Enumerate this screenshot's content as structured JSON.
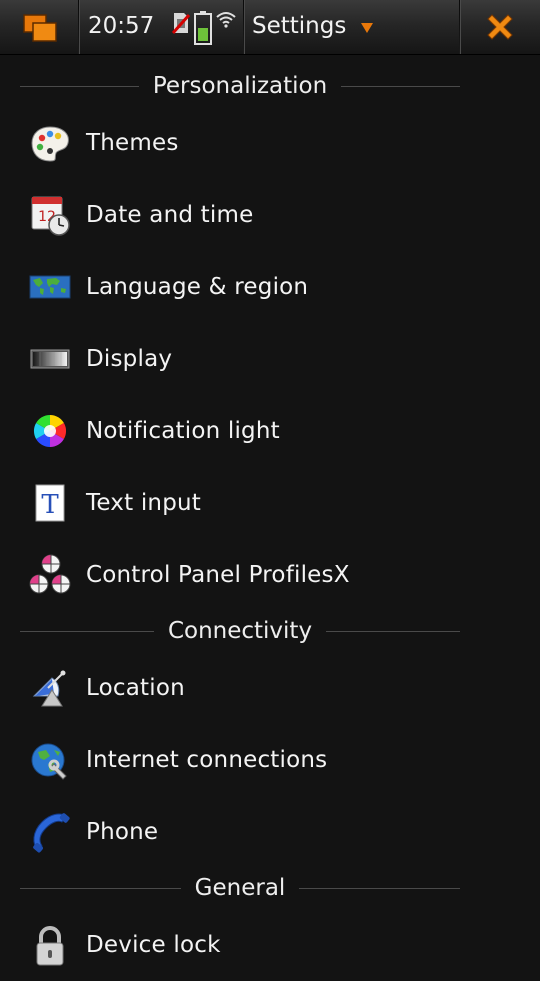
{
  "statusbar": {
    "time": "20:57",
    "menu_title": "Settings"
  },
  "sections": [
    {
      "header": "Personalization",
      "items": [
        {
          "label": "Themes",
          "icon": "palette-icon"
        },
        {
          "label": "Date and time",
          "icon": "calendar-clock-icon"
        },
        {
          "label": "Language & region",
          "icon": "world-map-icon"
        },
        {
          "label": "Display",
          "icon": "brightness-icon"
        },
        {
          "label": "Notification light",
          "icon": "color-wheel-icon"
        },
        {
          "label": "Text input",
          "icon": "text-input-icon"
        },
        {
          "label": "Control Panel ProfilesX",
          "icon": "profiles-icon"
        }
      ]
    },
    {
      "header": "Connectivity",
      "items": [
        {
          "label": "Location",
          "icon": "satellite-icon"
        },
        {
          "label": "Internet connections",
          "icon": "globe-wrench-icon"
        },
        {
          "label": "Phone",
          "icon": "phone-icon"
        }
      ]
    },
    {
      "header": "General",
      "items": [
        {
          "label": "Device lock",
          "icon": "padlock-icon"
        }
      ]
    }
  ],
  "colors": {
    "background": "#131313",
    "accent": "#e8780a",
    "text": "#f4f4f4"
  }
}
